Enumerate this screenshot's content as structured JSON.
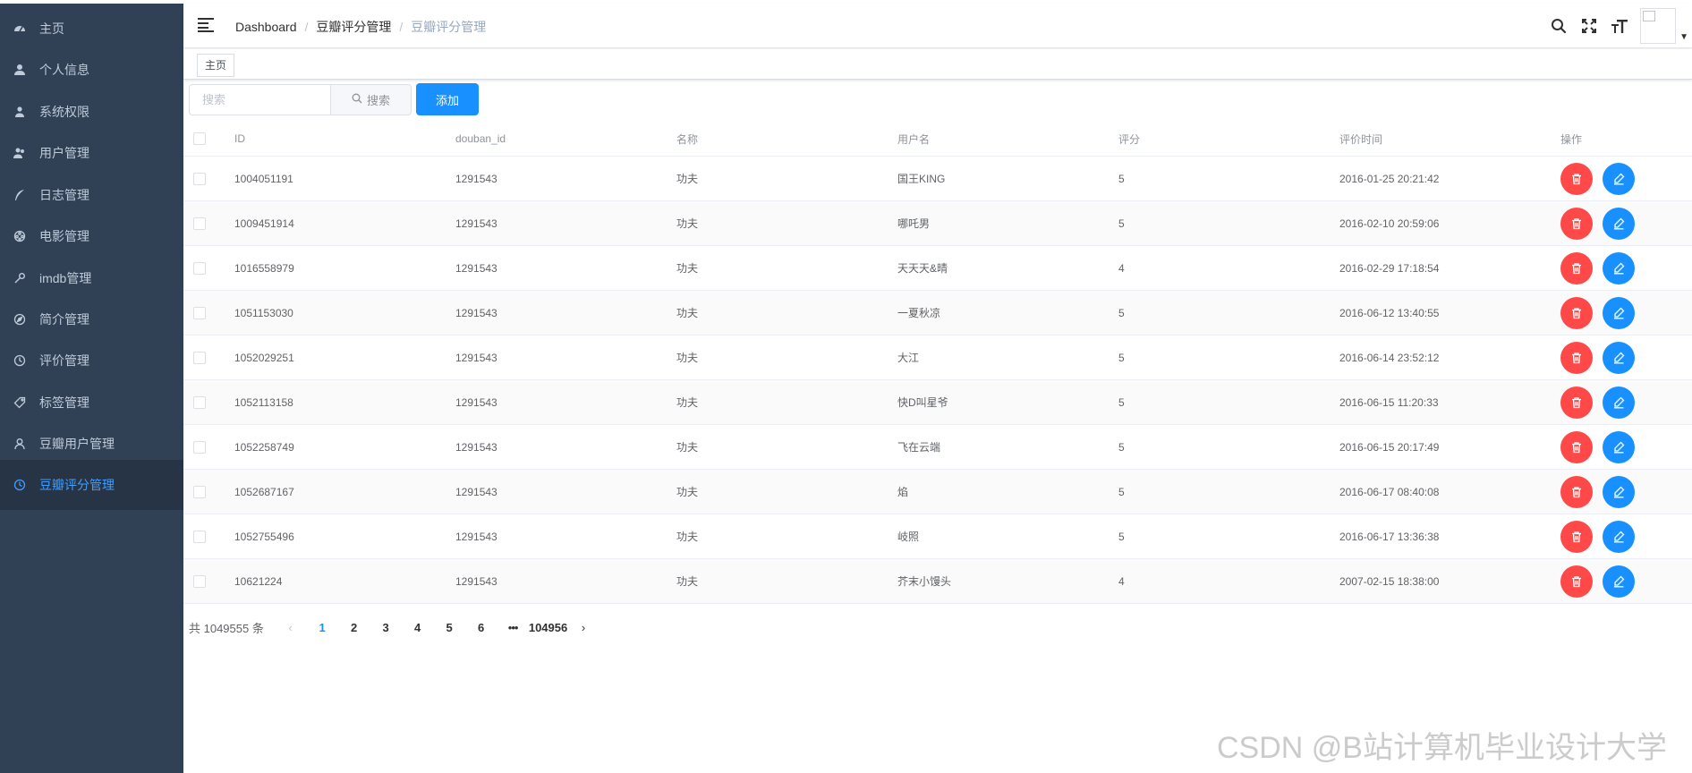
{
  "sidebar": {
    "items": [
      {
        "label": "主页",
        "icon": "dashboard-icon"
      },
      {
        "label": "个人信息",
        "icon": "user-icon"
      },
      {
        "label": "系统权限",
        "icon": "permission-icon"
      },
      {
        "label": "用户管理",
        "icon": "peoples-icon"
      },
      {
        "label": "日志管理",
        "icon": "feather-icon"
      },
      {
        "label": "电影管理",
        "icon": "film-icon"
      },
      {
        "label": "imdb管理",
        "icon": "wrench-icon"
      },
      {
        "label": "简介管理",
        "icon": "compass-icon"
      },
      {
        "label": "评价管理",
        "icon": "clock-icon"
      },
      {
        "label": "标签管理",
        "icon": "tag-icon"
      },
      {
        "label": "豆瓣用户管理",
        "icon": "person-icon"
      },
      {
        "label": "豆瓣评分管理",
        "icon": "clock-icon",
        "active": true
      }
    ]
  },
  "header": {
    "breadcrumb": [
      "Dashboard",
      "豆瓣评分管理",
      "豆瓣评分管理"
    ],
    "icons": [
      "search-icon",
      "fullscreen-icon",
      "font-size-icon"
    ]
  },
  "tags": {
    "items": [
      "主页"
    ]
  },
  "toolbar": {
    "search_placeholder": "搜索",
    "search_button": "搜索",
    "add_button": "添加"
  },
  "table": {
    "columns": [
      "ID",
      "douban_id",
      "名称",
      "用户名",
      "评分",
      "评价时间",
      "操作"
    ],
    "rows": [
      [
        "1004051191",
        "1291543",
        "功夫",
        "国王KING",
        "5",
        "2016-01-25 20:21:42"
      ],
      [
        "1009451914",
        "1291543",
        "功夫",
        "哪吒男",
        "5",
        "2016-02-10 20:59:06"
      ],
      [
        "1016558979",
        "1291543",
        "功夫",
        "天天天&晴",
        "4",
        "2016-02-29 17:18:54"
      ],
      [
        "1051153030",
        "1291543",
        "功夫",
        "一夏秋凉",
        "5",
        "2016-06-12 13:40:55"
      ],
      [
        "1052029251",
        "1291543",
        "功夫",
        "大江",
        "5",
        "2016-06-14 23:52:12"
      ],
      [
        "1052113158",
        "1291543",
        "功夫",
        "快D叫星爷",
        "5",
        "2016-06-15 11:20:33"
      ],
      [
        "1052258749",
        "1291543",
        "功夫",
        "飞在云端",
        "5",
        "2016-06-15 20:17:49"
      ],
      [
        "1052687167",
        "1291543",
        "功夫",
        "焰",
        "5",
        "2016-06-17 08:40:08"
      ],
      [
        "1052755496",
        "1291543",
        "功夫",
        "岐照",
        "5",
        "2016-06-17 13:36:38"
      ],
      [
        "10621224",
        "1291543",
        "功夫",
        "芥末小馒头",
        "4",
        "2007-02-15 18:38:00"
      ]
    ]
  },
  "pagination": {
    "total_text": "共 1049555 条",
    "pages": [
      "1",
      "2",
      "3",
      "4",
      "5",
      "6"
    ],
    "more": "•••",
    "last_page": "104956",
    "current": "1"
  },
  "watermark": "CSDN @B站计算机毕业设计大学",
  "colors": {
    "sidebar_bg": "#304156",
    "sidebar_active_text": "#409eff",
    "primary": "#1890ff",
    "danger": "#ff4949"
  }
}
